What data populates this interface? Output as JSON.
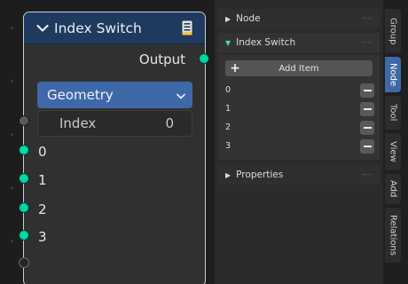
{
  "node": {
    "title": "Index Switch",
    "output_label": "Output",
    "type_dropdown": "Geometry",
    "index_field": {
      "label": "Index",
      "value": "0"
    },
    "items": [
      "0",
      "1",
      "2",
      "3"
    ]
  },
  "sidebar": {
    "node_section": "Node",
    "index_switch_section": "Index Switch",
    "add_item_label": "Add Item",
    "list_items": [
      "0",
      "1",
      "2",
      "3"
    ],
    "properties_section": "Properties"
  },
  "tabs": [
    "Group",
    "Node",
    "Tool",
    "View",
    "Add",
    "Relations"
  ],
  "active_tab": "Node",
  "colors": {
    "header": "#1e3a5e",
    "dropdown": "#3f68a8",
    "geometry_socket": "#00d6a3",
    "active_tab": "#3f68a8"
  },
  "icons": {
    "collapse": "chevron-down-icon",
    "preview": "node-preview-icon",
    "add": "plus-icon",
    "remove": "minus-icon",
    "expand": "triangle-right-icon",
    "collapse_panel": "triangle-down-icon"
  }
}
